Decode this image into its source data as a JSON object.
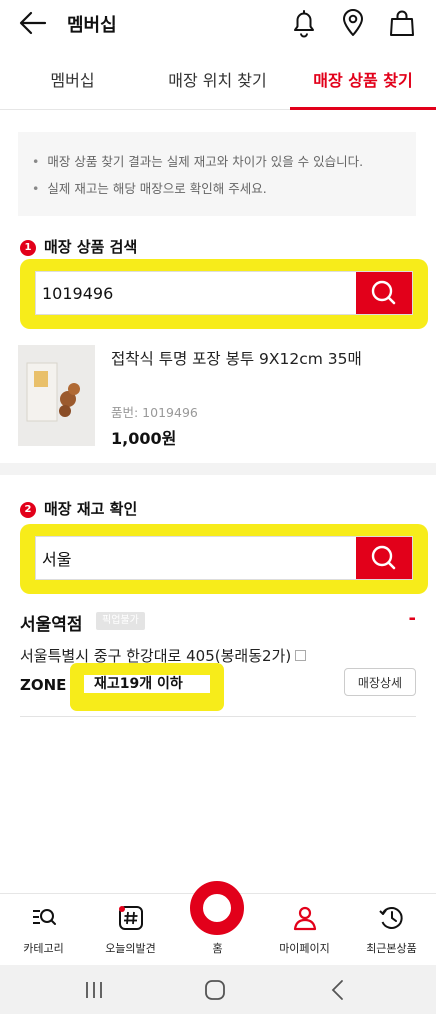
{
  "header": {
    "title": "멤버십",
    "icons": [
      "back-arrow-icon",
      "bell-icon",
      "location-pin-icon",
      "shopping-bag-icon"
    ]
  },
  "tabs": [
    {
      "label": "멤버십",
      "active": false
    },
    {
      "label": "매장 위치 찾기",
      "active": false
    },
    {
      "label": "매장 상품 찾기",
      "active": true
    }
  ],
  "notice": {
    "lines": [
      "매장 상품 찾기 결과는 실제 재고와 차이가 있을 수 있습니다.",
      "실제 재고는 해당 매장으로 확인해 주세요."
    ]
  },
  "product_search": {
    "step": "1",
    "title": "매장 상품 검색",
    "value": "1019496"
  },
  "product": {
    "name": "접착식 투명 포장 봉투 9X12cm 35매",
    "code": "품번: 1019496",
    "price": "1,000원"
  },
  "stock_check": {
    "step": "2",
    "title": "매장 재고 확인",
    "value": "서울"
  },
  "store": {
    "name": "서울역점",
    "badge": "픽업불가",
    "dash": "-",
    "address": "서울특별시 중구 한강대로 405(봉래동2가)",
    "zone": "ZONE -",
    "stock": "재고19개 이하",
    "detail_button": "매장상세"
  },
  "bottom_nav": [
    {
      "label": "카테고리",
      "icon": "category-search-icon"
    },
    {
      "label": "오늘의발견",
      "icon": "hashtag-icon"
    },
    {
      "label": "홈",
      "icon": "home-ring-icon"
    },
    {
      "label": "마이페이지",
      "icon": "person-icon"
    },
    {
      "label": "최근본상품",
      "icon": "recent-history-icon"
    }
  ],
  "colors": {
    "brand": "#e2001a",
    "highlight": "#f7ec1a",
    "notice_bg": "#f6f6f6"
  }
}
